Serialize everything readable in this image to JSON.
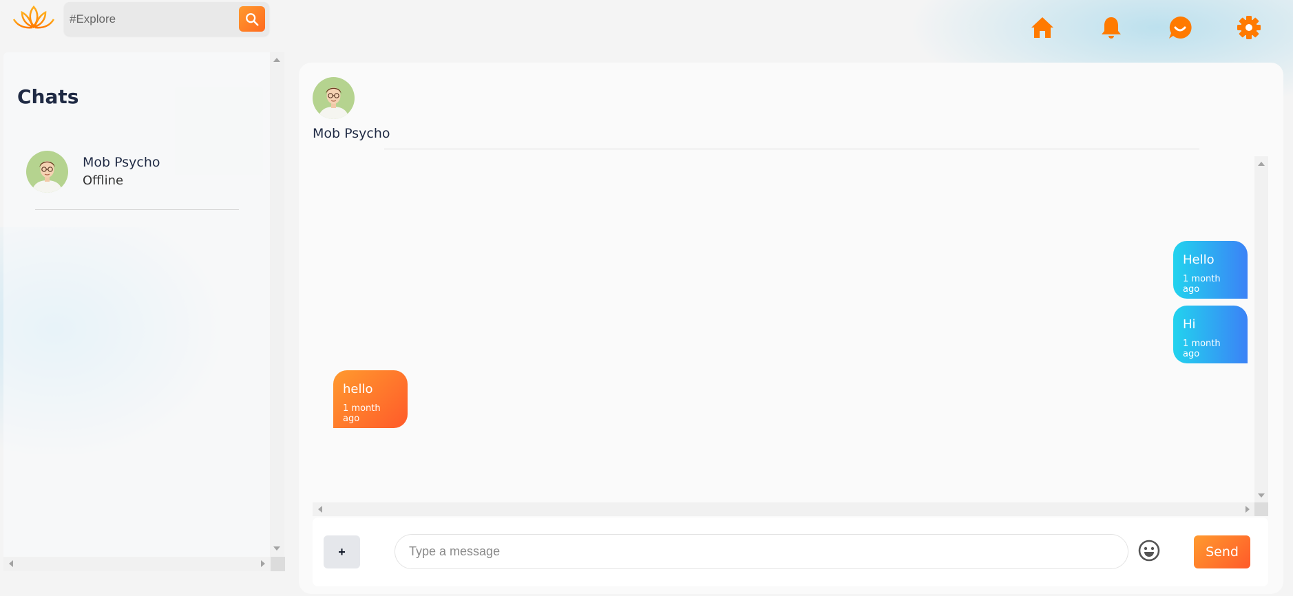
{
  "topbar": {
    "search": {
      "placeholder": "#Explore",
      "value": ""
    },
    "nav_icons": [
      "home-icon",
      "bell-icon",
      "chat-icon",
      "gear-icon"
    ],
    "accent_color": "#ff7a00"
  },
  "sidebar": {
    "title": "Chats",
    "items": [
      {
        "name": "Mob Psycho",
        "status": "Offline"
      }
    ]
  },
  "conversation": {
    "contact_name": "Mob Psycho",
    "messages": [
      {
        "direction": "sent",
        "text": "Hello",
        "time": "1 month ago"
      },
      {
        "direction": "sent",
        "text": "Hi",
        "time": "1 month ago"
      },
      {
        "direction": "received",
        "text": "hello",
        "time": "1 month ago"
      }
    ],
    "sent_bubble_colors": [
      "#22d3ee",
      "#3b82f6"
    ],
    "received_bubble_colors": [
      "#ff9a2e",
      "#ff5a2a"
    ]
  },
  "composer": {
    "attach_label": "+",
    "placeholder": "Type a message",
    "value": "",
    "send_label": "Send"
  }
}
